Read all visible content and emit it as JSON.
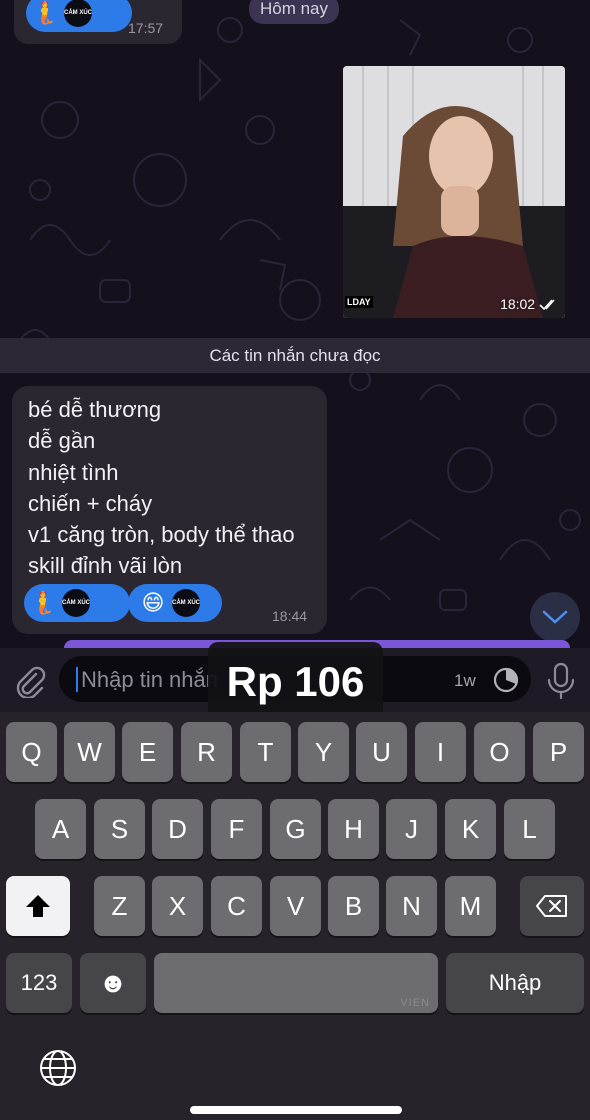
{
  "chat": {
    "date_label": "Hôm nay",
    "top_message_time": "17:57",
    "reaction_badge": "CẢM XÚC",
    "photo": {
      "stamp": "LDAY",
      "time": "18:02"
    },
    "unread_label": "Các tin nhắn chưa đọc",
    "message": {
      "lines": [
        "bé dễ thương",
        "dễ gần",
        "nhiệt tình",
        "chiến + cháy",
        "v1 căng tròn, body thể thao",
        "skill đỉnh vãi lòn"
      ],
      "time": "18:44",
      "emoji": "😄"
    }
  },
  "input": {
    "placeholder": "Nhập tin nhắn",
    "timer_label": "1w"
  },
  "overlay": {
    "label": "Rp 106"
  },
  "keyboard": {
    "row1": [
      "Q",
      "W",
      "E",
      "R",
      "T",
      "Y",
      "U",
      "I",
      "O",
      "P"
    ],
    "row2": [
      "A",
      "S",
      "D",
      "F",
      "G",
      "H",
      "J",
      "K",
      "L"
    ],
    "row3": [
      "Z",
      "X",
      "C",
      "V",
      "B",
      "N",
      "M"
    ],
    "numbers_key": "123",
    "emoji_key": "☻",
    "return_key": "Nhập",
    "space_brand": "VIEN"
  },
  "colors": {
    "chat_bg": "#14101c",
    "bubble": "#2a2731",
    "reaction_chip": "#2d7be8",
    "accent_purple": "#7b56d8",
    "caret_blue": "#2e7bf6"
  }
}
